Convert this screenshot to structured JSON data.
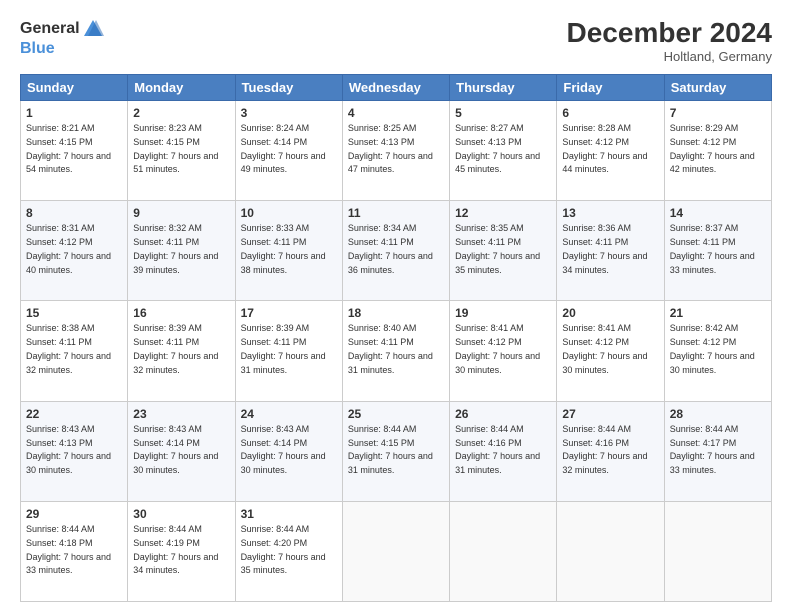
{
  "header": {
    "logo_general": "General",
    "logo_blue": "Blue",
    "title": "December 2024",
    "location": "Holtland, Germany"
  },
  "days_of_week": [
    "Sunday",
    "Monday",
    "Tuesday",
    "Wednesday",
    "Thursday",
    "Friday",
    "Saturday"
  ],
  "weeks": [
    [
      {
        "day": "1",
        "sunrise": "8:21 AM",
        "sunset": "4:15 PM",
        "daylight": "7 hours and 54 minutes."
      },
      {
        "day": "2",
        "sunrise": "8:23 AM",
        "sunset": "4:15 PM",
        "daylight": "7 hours and 51 minutes."
      },
      {
        "day": "3",
        "sunrise": "8:24 AM",
        "sunset": "4:14 PM",
        "daylight": "7 hours and 49 minutes."
      },
      {
        "day": "4",
        "sunrise": "8:25 AM",
        "sunset": "4:13 PM",
        "daylight": "7 hours and 47 minutes."
      },
      {
        "day": "5",
        "sunrise": "8:27 AM",
        "sunset": "4:13 PM",
        "daylight": "7 hours and 45 minutes."
      },
      {
        "day": "6",
        "sunrise": "8:28 AM",
        "sunset": "4:12 PM",
        "daylight": "7 hours and 44 minutes."
      },
      {
        "day": "7",
        "sunrise": "8:29 AM",
        "sunset": "4:12 PM",
        "daylight": "7 hours and 42 minutes."
      }
    ],
    [
      {
        "day": "8",
        "sunrise": "8:31 AM",
        "sunset": "4:12 PM",
        "daylight": "7 hours and 40 minutes."
      },
      {
        "day": "9",
        "sunrise": "8:32 AM",
        "sunset": "4:11 PM",
        "daylight": "7 hours and 39 minutes."
      },
      {
        "day": "10",
        "sunrise": "8:33 AM",
        "sunset": "4:11 PM",
        "daylight": "7 hours and 38 minutes."
      },
      {
        "day": "11",
        "sunrise": "8:34 AM",
        "sunset": "4:11 PM",
        "daylight": "7 hours and 36 minutes."
      },
      {
        "day": "12",
        "sunrise": "8:35 AM",
        "sunset": "4:11 PM",
        "daylight": "7 hours and 35 minutes."
      },
      {
        "day": "13",
        "sunrise": "8:36 AM",
        "sunset": "4:11 PM",
        "daylight": "7 hours and 34 minutes."
      },
      {
        "day": "14",
        "sunrise": "8:37 AM",
        "sunset": "4:11 PM",
        "daylight": "7 hours and 33 minutes."
      }
    ],
    [
      {
        "day": "15",
        "sunrise": "8:38 AM",
        "sunset": "4:11 PM",
        "daylight": "7 hours and 32 minutes."
      },
      {
        "day": "16",
        "sunrise": "8:39 AM",
        "sunset": "4:11 PM",
        "daylight": "7 hours and 32 minutes."
      },
      {
        "day": "17",
        "sunrise": "8:39 AM",
        "sunset": "4:11 PM",
        "daylight": "7 hours and 31 minutes."
      },
      {
        "day": "18",
        "sunrise": "8:40 AM",
        "sunset": "4:11 PM",
        "daylight": "7 hours and 31 minutes."
      },
      {
        "day": "19",
        "sunrise": "8:41 AM",
        "sunset": "4:12 PM",
        "daylight": "7 hours and 30 minutes."
      },
      {
        "day": "20",
        "sunrise": "8:41 AM",
        "sunset": "4:12 PM",
        "daylight": "7 hours and 30 minutes."
      },
      {
        "day": "21",
        "sunrise": "8:42 AM",
        "sunset": "4:12 PM",
        "daylight": "7 hours and 30 minutes."
      }
    ],
    [
      {
        "day": "22",
        "sunrise": "8:43 AM",
        "sunset": "4:13 PM",
        "daylight": "7 hours and 30 minutes."
      },
      {
        "day": "23",
        "sunrise": "8:43 AM",
        "sunset": "4:14 PM",
        "daylight": "7 hours and 30 minutes."
      },
      {
        "day": "24",
        "sunrise": "8:43 AM",
        "sunset": "4:14 PM",
        "daylight": "7 hours and 30 minutes."
      },
      {
        "day": "25",
        "sunrise": "8:44 AM",
        "sunset": "4:15 PM",
        "daylight": "7 hours and 31 minutes."
      },
      {
        "day": "26",
        "sunrise": "8:44 AM",
        "sunset": "4:16 PM",
        "daylight": "7 hours and 31 minutes."
      },
      {
        "day": "27",
        "sunrise": "8:44 AM",
        "sunset": "4:16 PM",
        "daylight": "7 hours and 32 minutes."
      },
      {
        "day": "28",
        "sunrise": "8:44 AM",
        "sunset": "4:17 PM",
        "daylight": "7 hours and 33 minutes."
      }
    ],
    [
      {
        "day": "29",
        "sunrise": "8:44 AM",
        "sunset": "4:18 PM",
        "daylight": "7 hours and 33 minutes."
      },
      {
        "day": "30",
        "sunrise": "8:44 AM",
        "sunset": "4:19 PM",
        "daylight": "7 hours and 34 minutes."
      },
      {
        "day": "31",
        "sunrise": "8:44 AM",
        "sunset": "4:20 PM",
        "daylight": "7 hours and 35 minutes."
      },
      null,
      null,
      null,
      null
    ]
  ]
}
